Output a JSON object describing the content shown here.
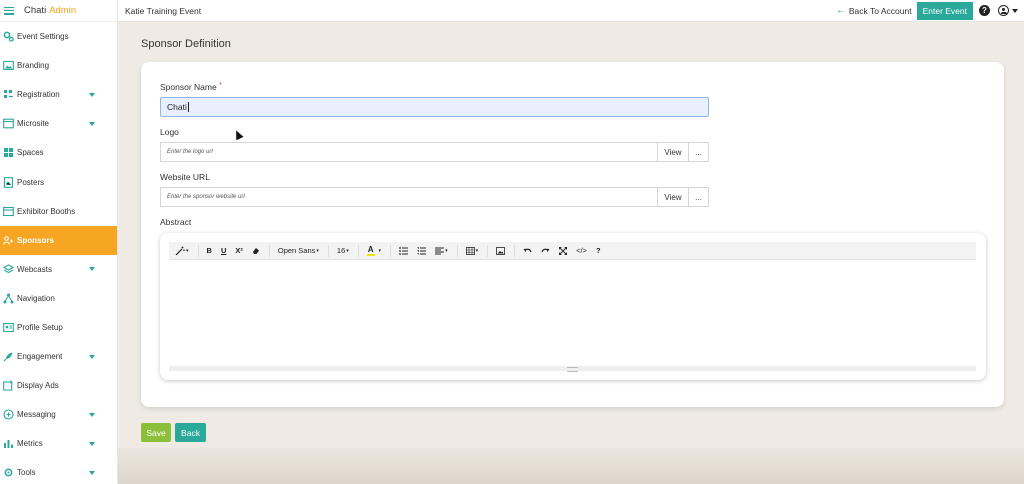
{
  "app": {
    "brand_name": "Chati",
    "brand_accent": "Admin",
    "event_name": "Katie Training Event"
  },
  "topbar": {
    "back_to_account": "Back To Account",
    "enter_event": "Enter Event"
  },
  "sidebar": {
    "items": [
      {
        "label": "Event Settings",
        "icon": "gears-icon",
        "has_caret": false
      },
      {
        "label": "Branding",
        "icon": "image-icon",
        "has_caret": false
      },
      {
        "label": "Registration",
        "icon": "registration-icon",
        "has_caret": true
      },
      {
        "label": "Microsite",
        "icon": "microsite-icon",
        "has_caret": true
      },
      {
        "label": "Spaces",
        "icon": "spaces-icon",
        "has_caret": false
      },
      {
        "label": "Posters",
        "icon": "posters-icon",
        "has_caret": false
      },
      {
        "label": "Exhibitor Booths",
        "icon": "booth-icon",
        "has_caret": false
      },
      {
        "label": "Sponsors",
        "icon": "sponsors-icon",
        "has_caret": false,
        "active": true
      },
      {
        "label": "Webcasts",
        "icon": "layers-icon",
        "has_caret": true
      },
      {
        "label": "Navigation",
        "icon": "sitemap-icon",
        "has_caret": false
      },
      {
        "label": "Profile Setup",
        "icon": "profile-card-icon",
        "has_caret": false
      },
      {
        "label": "Engagement",
        "icon": "rocket-icon",
        "has_caret": true
      },
      {
        "label": "Display Ads",
        "icon": "ads-icon",
        "has_caret": false
      },
      {
        "label": "Messaging",
        "icon": "message-icon",
        "has_caret": true
      },
      {
        "label": "Metrics",
        "icon": "bar-chart-icon",
        "has_caret": true
      },
      {
        "label": "Tools",
        "icon": "tools-icon",
        "has_caret": true
      }
    ]
  },
  "page": {
    "title": "Sponsor Definition"
  },
  "form": {
    "sponsor_name_label": "Sponsor Name",
    "required_mark": "*",
    "sponsor_name_value": "Chati",
    "logo_label": "Logo",
    "logo_placeholder": "Enter the logo url",
    "website_label": "Website URL",
    "website_placeholder": "Enter the sponsor website url",
    "view_label": "View",
    "more_label": "...",
    "abstract_label": "Abstract"
  },
  "editor_toolbar": {
    "bold": "B",
    "underline": "U",
    "superscript": "X²",
    "font_name": "Open Sans",
    "font_size": "16",
    "color_letter": "A",
    "code": "</>",
    "help": "?"
  },
  "actions": {
    "save": "Save",
    "back": "Back"
  },
  "colors": {
    "teal": "#2aa89a",
    "orange": "#f6a623",
    "green": "#8bbf3a"
  }
}
